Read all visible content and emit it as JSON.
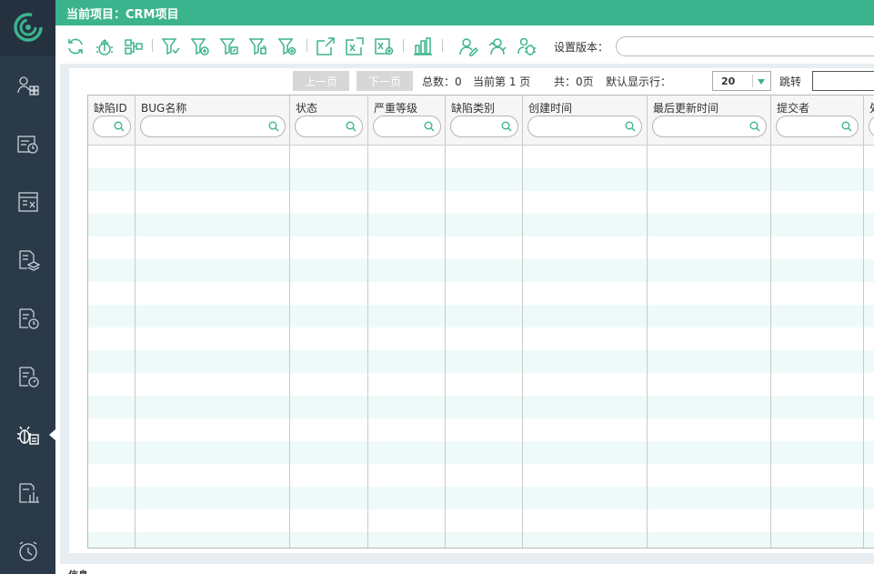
{
  "header": {
    "title": "当前项目：CRM项目"
  },
  "colors": {
    "accent": "#3bb48d",
    "sidebar": "#2b3a49",
    "row_alt": "#eefaf9"
  },
  "sidebar": {
    "logo": "swirl-logo-icon",
    "items": [
      {
        "icon": "users-grid-icon"
      },
      {
        "icon": "plan-clock-icon"
      },
      {
        "icon": "task-list-icon"
      },
      {
        "icon": "layers-doc-icon"
      },
      {
        "icon": "doc-clock-icon"
      },
      {
        "icon": "doc-gauge-icon"
      },
      {
        "icon": "bug-icon",
        "active": true
      },
      {
        "icon": "report-chart-icon"
      },
      {
        "icon": "alarm-clock-icon"
      }
    ]
  },
  "toolbar": {
    "buttons": [
      {
        "icon": "refresh-icon"
      },
      {
        "icon": "upload-bug-icon"
      },
      {
        "icon": "flow-icon"
      },
      {
        "icon": "filter-icon"
      },
      {
        "icon": "filter-add-icon"
      },
      {
        "icon": "filter-edit-icon"
      },
      {
        "icon": "filter-delete-icon"
      },
      {
        "icon": "filter-settings-icon"
      },
      {
        "icon": "export-icon"
      },
      {
        "icon": "excel-icon"
      },
      {
        "icon": "excel-settings-icon"
      },
      {
        "icon": "chart-icon"
      },
      {
        "icon": "user-edit-icon"
      },
      {
        "icon": "user-sync-icon"
      },
      {
        "icon": "user-bug-icon"
      }
    ],
    "version_label": "设置版本：",
    "version_value": ""
  },
  "pager": {
    "prev": "上一页",
    "next": "下一页",
    "total": "总数：0",
    "current": "当前第 1 页",
    "pages": "共：0页",
    "rows_label": "默认显示行：",
    "rows_value": "20",
    "jump_label": "跳转",
    "jump_value": ""
  },
  "grid": {
    "columns": [
      {
        "title": "缺陷ID"
      },
      {
        "title": "BUG名称"
      },
      {
        "title": "状态"
      },
      {
        "title": "严重等级"
      },
      {
        "title": "缺陷类别"
      },
      {
        "title": "创建时间"
      },
      {
        "title": "最后更新时间"
      },
      {
        "title": "提交者"
      },
      {
        "title": "处"
      }
    ],
    "rows": []
  },
  "footer": {
    "label": "信息"
  }
}
